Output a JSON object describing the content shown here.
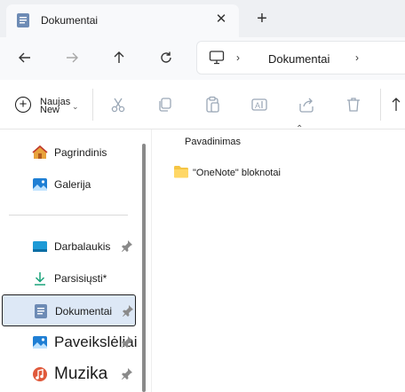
{
  "tab": {
    "title": "Dokumentai",
    "close_glyph": "✕",
    "new_tab_glyph": "+"
  },
  "address": {
    "chevron": "›",
    "location": "Dokumentai",
    "chevron_after": "›"
  },
  "toolbar": {
    "new_label": "Naujas",
    "new_label_overlay": "New",
    "new_chevron": "⌄",
    "icons": [
      "cut-icon",
      "copy-icon",
      "paste-icon",
      "rename-icon",
      "share-icon",
      "delete-icon",
      "sort-icon"
    ]
  },
  "sidebar": {
    "items": [
      {
        "label": "Pagrindinis",
        "icon": "home-icon",
        "pinned": false
      },
      {
        "label": "Galerija",
        "icon": "gallery-icon",
        "pinned": false
      },
      {
        "label": "Darbalaukis",
        "icon": "desktop-icon",
        "pinned": true
      },
      {
        "label": "Parsisiųsti*",
        "icon": "download-icon",
        "pinned": false
      },
      {
        "label": "Dokumentai",
        "icon": "documents-icon",
        "pinned": true,
        "selected": true
      },
      {
        "label": "Paveikslėliai",
        "icon": "pictures-icon",
        "pinned": true
      },
      {
        "label": "Muzika",
        "icon": "music-icon",
        "pinned": true
      }
    ]
  },
  "content": {
    "column_header": "Pavadinimas",
    "sort_caret": "⌃",
    "files": [
      {
        "name": "\"OneNote\" bloknotai",
        "type": "folder"
      }
    ]
  },
  "colors": {
    "accent": "#0067c0",
    "selected_bg": "#dde8f6",
    "folder": "#f5c544"
  }
}
